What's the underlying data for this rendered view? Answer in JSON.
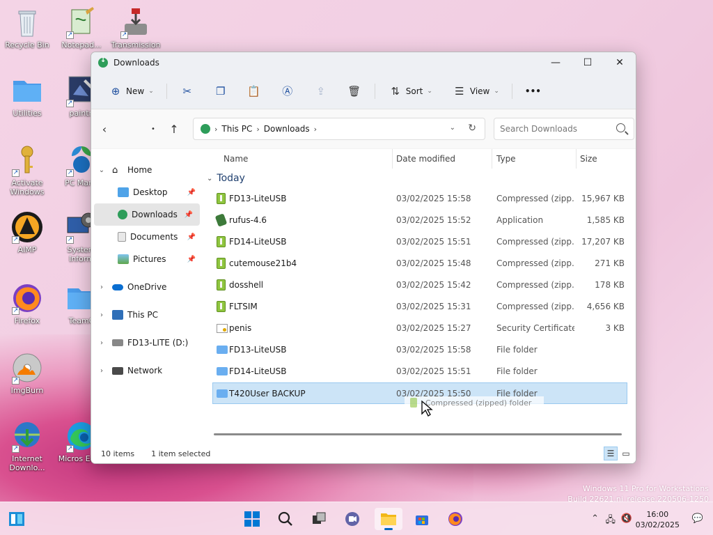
{
  "desktop": {
    "icons": [
      {
        "label": "Recycle Bin"
      },
      {
        "label": "Notepad..."
      },
      {
        "label": "Transmission"
      },
      {
        "label": "Utilities"
      },
      {
        "label": "paintn"
      },
      {
        "label": "Activate Windows"
      },
      {
        "label": "PC Mana"
      },
      {
        "label": "AIMP"
      },
      {
        "label": "System Inform"
      },
      {
        "label": "Firefox"
      },
      {
        "label": "TeamC"
      },
      {
        "label": "ImgBurn"
      },
      {
        "label": "Internet Downlo..."
      },
      {
        "label": "Micros Edge"
      }
    ],
    "watermark_line1": "Windows 11 Pro for Workstations",
    "watermark_line2": "Build 22621.ni_release.220506-1250"
  },
  "window": {
    "title": "Downloads",
    "controls": {
      "minimize": "—",
      "maximize": "☐",
      "close": "✕"
    }
  },
  "toolbar": {
    "new_label": "New",
    "sort_label": "Sort",
    "view_label": "View",
    "more_label": "•••"
  },
  "address": {
    "crumbs": [
      "This PC",
      "Downloads"
    ],
    "search_placeholder": "Search Downloads"
  },
  "nav": {
    "home": "Home",
    "pinned": [
      "Desktop",
      "Downloads",
      "Documents",
      "Pictures"
    ],
    "roots": [
      "OneDrive",
      "This PC",
      "FD13-LITE (D:)",
      "Network"
    ]
  },
  "columns": {
    "name": "Name",
    "date": "Date modified",
    "type": "Type",
    "size": "Size"
  },
  "group": "Today",
  "files": [
    {
      "name": "FD13-LiteUSB",
      "date": "03/02/2025 15:58",
      "type": "Compressed (zipp...",
      "size": "15,967 KB",
      "icon": "zip"
    },
    {
      "name": "rufus-4.6",
      "date": "03/02/2025 15:52",
      "type": "Application",
      "size": "1,585 KB",
      "icon": "app"
    },
    {
      "name": "FD14-LiteUSB",
      "date": "03/02/2025 15:51",
      "type": "Compressed (zipp...",
      "size": "17,207 KB",
      "icon": "zip"
    },
    {
      "name": "cutemouse21b4",
      "date": "03/02/2025 15:48",
      "type": "Compressed (zipp...",
      "size": "271 KB",
      "icon": "zip"
    },
    {
      "name": "dosshell",
      "date": "03/02/2025 15:42",
      "type": "Compressed (zipp...",
      "size": "178 KB",
      "icon": "zip"
    },
    {
      "name": "FLTSIM",
      "date": "03/02/2025 15:31",
      "type": "Compressed (zipp...",
      "size": "4,656 KB",
      "icon": "zip"
    },
    {
      "name": "penis",
      "date": "03/02/2025 15:27",
      "type": "Security Certificate",
      "size": "3 KB",
      "icon": "cert"
    },
    {
      "name": "FD13-LiteUSB",
      "date": "03/02/2025 15:58",
      "type": "File folder",
      "size": "",
      "icon": "folder"
    },
    {
      "name": "FD14-LiteUSB",
      "date": "03/02/2025 15:51",
      "type": "File folder",
      "size": "",
      "icon": "folder"
    },
    {
      "name": "T420User BACKUP",
      "date": "03/02/2025 15:50",
      "type": "File folder",
      "size": "",
      "icon": "folder"
    }
  ],
  "drag_ghost_text": "Compressed (zipped) folder",
  "status": {
    "items": "10 items",
    "selected": "1 item selected"
  },
  "taskbar": {
    "time": "16:00",
    "date": "03/02/2025"
  }
}
